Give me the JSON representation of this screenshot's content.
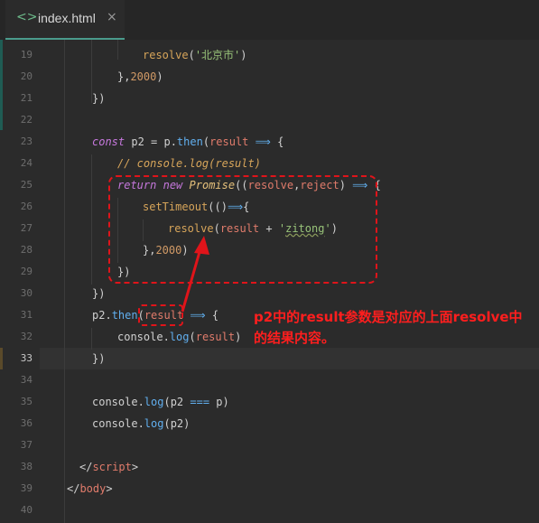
{
  "tab": {
    "icon": "code-file-icon",
    "title": "index.html",
    "close": "×"
  },
  "lines": [
    {
      "n": "19"
    },
    {
      "n": "20"
    },
    {
      "n": "21"
    },
    {
      "n": "22"
    },
    {
      "n": "23"
    },
    {
      "n": "24"
    },
    {
      "n": "25"
    },
    {
      "n": "26"
    },
    {
      "n": "27"
    },
    {
      "n": "28"
    },
    {
      "n": "29"
    },
    {
      "n": "30"
    },
    {
      "n": "31"
    },
    {
      "n": "32"
    },
    {
      "n": "33"
    },
    {
      "n": "34"
    },
    {
      "n": "35"
    },
    {
      "n": "36"
    },
    {
      "n": "37"
    },
    {
      "n": "38"
    },
    {
      "n": "39"
    },
    {
      "n": "40"
    }
  ],
  "current_line": "33",
  "code": {
    "l19": {
      "fn": "resolve",
      "p1": "(",
      "str": "'北京市'",
      "p2": ")"
    },
    "l20": {
      "t1": "},",
      "num": "2000",
      "t2": ")"
    },
    "l21": {
      "t1": "})"
    },
    "l23": {
      "kw": "const",
      "t1": " p2 = p.",
      "fn": "then",
      "t2": "(",
      "var": "result",
      "t3": " ",
      "op": "⟹",
      "t4": " {"
    },
    "l24": {
      "cmt": "// console.log(result)"
    },
    "l25": {
      "kw": "return",
      "t1": " ",
      "kw2": "new",
      "t2": " ",
      "cls": "Promise",
      "t3": "((",
      "v1": "resolve",
      "t4": ",",
      "v2": "reject",
      "t5": ") ",
      "op": "⟹",
      "t6": " {"
    },
    "l26": {
      "fn": "setTimeout",
      "t1": "(()",
      "op": "⟹",
      "t2": "{"
    },
    "l27": {
      "fn": "resolve",
      "t1": "(",
      "var": "result",
      "t2": " + ",
      "str1": "'",
      "sq": "zitong",
      "str2": "'",
      "t3": ")"
    },
    "l28": {
      "t1": "},",
      "num": "2000",
      "t2": ")"
    },
    "l29": {
      "t1": "})"
    },
    "l30": {
      "t1": "})"
    },
    "l31": {
      "t1": "p2.",
      "fn": "then",
      "t2": "(",
      "var": "result",
      "t3": " ",
      "op": "⟹",
      "t4": " {"
    },
    "l32": {
      "t1": "console.",
      "fn": "log",
      "t2": "(",
      "var": "result",
      "t3": ")"
    },
    "l33": {
      "t1": "})"
    },
    "l35": {
      "t1": "console.",
      "fn": "log",
      "t2": "(p2 ",
      "op": "===",
      "t3": " p)"
    },
    "l36": {
      "t1": "console.",
      "fn": "log",
      "t2": "(p2)"
    },
    "l38": {
      "t1": "</",
      "tag": "script",
      "t2": ">"
    },
    "l39": {
      "t1": "</",
      "tag": "body",
      "t2": ">"
    }
  },
  "annotation": "p2中的result参数是对应的上面resolve中的结果内容。",
  "colors": {
    "annotation": "#ff1e1e",
    "background": "#2b2b2b",
    "accent": "#4a9b8c"
  }
}
